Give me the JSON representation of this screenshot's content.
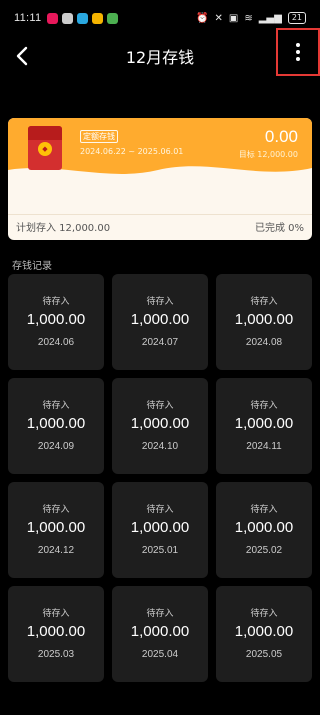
{
  "status_bar": {
    "time": "11:11",
    "notification_icons": [
      {
        "name": "video-app-icon",
        "color": "#e8185b"
      },
      {
        "name": "wechat-icon",
        "color": "#cccccc"
      },
      {
        "name": "chat-app-icon",
        "color": "#2aa8e0"
      },
      {
        "name": "taobao-icon",
        "color": "#f5b400"
      },
      {
        "name": "security-app-icon",
        "color": "#4caf50"
      }
    ],
    "battery": "21"
  },
  "nav": {
    "title": "12月存钱",
    "back_icon": "chevron-left-icon",
    "more_icon": "vertical-dots-icon"
  },
  "summary": {
    "tag": "定额存钱",
    "date_range": "2024.06.22 ~ 2025.06.01",
    "saved": "0.00",
    "target": "目标 12,000.00",
    "planned": "计划存入 12,000.00",
    "progress": "已完成 0%",
    "accent_color": "#ffab2e",
    "envelope_color": "#d32f2f"
  },
  "records": {
    "title": "存钱记录",
    "items": [
      {
        "status": "待存入",
        "amount": "1,000.00",
        "month": "2024.06"
      },
      {
        "status": "待存入",
        "amount": "1,000.00",
        "month": "2024.07"
      },
      {
        "status": "待存入",
        "amount": "1,000.00",
        "month": "2024.08"
      },
      {
        "status": "待存入",
        "amount": "1,000.00",
        "month": "2024.09"
      },
      {
        "status": "待存入",
        "amount": "1,000.00",
        "month": "2024.10"
      },
      {
        "status": "待存入",
        "amount": "1,000.00",
        "month": "2024.11"
      },
      {
        "status": "待存入",
        "amount": "1,000.00",
        "month": "2024.12"
      },
      {
        "status": "待存入",
        "amount": "1,000.00",
        "month": "2025.01"
      },
      {
        "status": "待存入",
        "amount": "1,000.00",
        "month": "2025.02"
      },
      {
        "status": "待存入",
        "amount": "1,000.00",
        "month": "2025.03"
      },
      {
        "status": "待存入",
        "amount": "1,000.00",
        "month": "2025.04"
      },
      {
        "status": "待存入",
        "amount": "1,000.00",
        "month": "2025.05"
      }
    ]
  }
}
